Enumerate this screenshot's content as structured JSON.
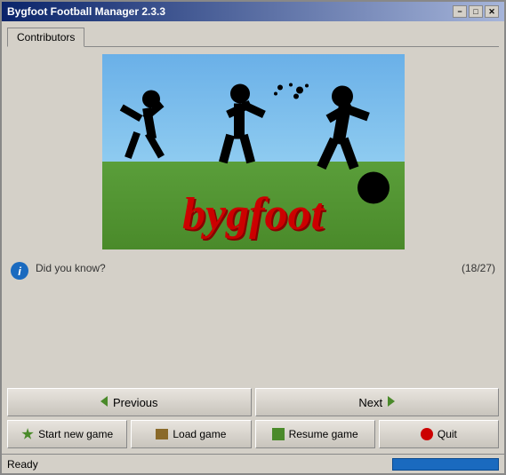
{
  "window": {
    "title": "Bygfoot Football Manager 2.3.3",
    "minimize_label": "−",
    "maximize_label": "□",
    "close_label": "✕"
  },
  "tabs": [
    {
      "label": "Contributors",
      "active": true
    }
  ],
  "logo": {
    "text": "bygfoot"
  },
  "info": {
    "icon_label": "i",
    "did_you_know": "Did you know?",
    "counter": "(18/27)"
  },
  "nav": {
    "previous_label": "Previous",
    "next_label": "Next"
  },
  "actions": {
    "start_new_game_label": "Start new game",
    "load_game_label": "Load game",
    "resume_game_label": "Resume game",
    "quit_label": "Quit"
  },
  "status": {
    "text": "Ready"
  }
}
